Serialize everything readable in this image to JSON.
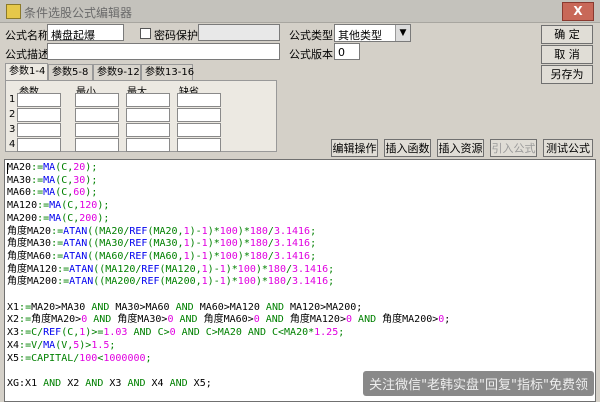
{
  "window": {
    "title": "条件选股公式编辑器",
    "close_label": "X"
  },
  "form": {
    "name_label": "公式名称",
    "name_value": "横盘起爆",
    "password_label": "密码保护",
    "password_checked": false,
    "type_label": "公式类型",
    "type_value": "其他类型",
    "desc_label": "公式描述",
    "desc_value": "",
    "version_label": "公式版本",
    "version_value": "0"
  },
  "buttons": {
    "ok": "确  定",
    "cancel": "取  消",
    "save_as": "另存为",
    "edit_op": "编辑操作",
    "insert_func": "插入函数",
    "insert_resource": "插入资源",
    "import_formula": "引入公式",
    "test_formula": "测试公式"
  },
  "param_tabs": [
    "参数1-4",
    "参数5-8",
    "参数9-12",
    "参数13-16"
  ],
  "param_columns": [
    "参数",
    "最小",
    "最大",
    "缺省"
  ],
  "param_rows": [
    "1",
    "2",
    "3",
    "4"
  ],
  "code_lines": [
    [
      [
        "MA20",
        "plain"
      ],
      [
        ":=",
        "op"
      ],
      [
        "MA",
        "fn"
      ],
      [
        "(C,",
        "op"
      ],
      [
        "20",
        "nm"
      ],
      [
        ");",
        "op"
      ]
    ],
    [
      [
        "MA30",
        "plain"
      ],
      [
        ":=",
        "op"
      ],
      [
        "MA",
        "fn"
      ],
      [
        "(C,",
        "op"
      ],
      [
        "30",
        "nm"
      ],
      [
        ");",
        "op"
      ]
    ],
    [
      [
        "MA60",
        "plain"
      ],
      [
        ":=",
        "op"
      ],
      [
        "MA",
        "fn"
      ],
      [
        "(C,",
        "op"
      ],
      [
        "60",
        "nm"
      ],
      [
        ");",
        "op"
      ]
    ],
    [
      [
        "MA120",
        "plain"
      ],
      [
        ":=",
        "op"
      ],
      [
        "MA",
        "fn"
      ],
      [
        "(C,",
        "op"
      ],
      [
        "120",
        "nm"
      ],
      [
        ");",
        "op"
      ]
    ],
    [
      [
        "MA200",
        "plain"
      ],
      [
        ":=",
        "op"
      ],
      [
        "MA",
        "fn"
      ],
      [
        "(C,",
        "op"
      ],
      [
        "200",
        "nm"
      ],
      [
        ");",
        "op"
      ]
    ],
    [
      [
        "角度MA20",
        "plain"
      ],
      [
        ":=",
        "op"
      ],
      [
        "ATAN",
        "fn"
      ],
      [
        "((MA20/",
        "op"
      ],
      [
        "REF",
        "fn"
      ],
      [
        "(MA20,",
        "op"
      ],
      [
        "1",
        "nm"
      ],
      [
        ")-",
        "op"
      ],
      [
        "1",
        "nm"
      ],
      [
        ")*",
        "op"
      ],
      [
        "100",
        "nm"
      ],
      [
        ")*",
        "op"
      ],
      [
        "180",
        "nm"
      ],
      [
        "/",
        "op"
      ],
      [
        "3.1416",
        "nm"
      ],
      [
        ";",
        "op"
      ]
    ],
    [
      [
        "角度MA30",
        "plain"
      ],
      [
        ":=",
        "op"
      ],
      [
        "ATAN",
        "fn"
      ],
      [
        "((MA30/",
        "op"
      ],
      [
        "REF",
        "fn"
      ],
      [
        "(MA30,",
        "op"
      ],
      [
        "1",
        "nm"
      ],
      [
        ")-",
        "op"
      ],
      [
        "1",
        "nm"
      ],
      [
        ")*",
        "op"
      ],
      [
        "100",
        "nm"
      ],
      [
        ")*",
        "op"
      ],
      [
        "180",
        "nm"
      ],
      [
        "/",
        "op"
      ],
      [
        "3.1416",
        "nm"
      ],
      [
        ";",
        "op"
      ]
    ],
    [
      [
        "角度MA60",
        "plain"
      ],
      [
        ":=",
        "op"
      ],
      [
        "ATAN",
        "fn"
      ],
      [
        "((MA60/",
        "op"
      ],
      [
        "REF",
        "fn"
      ],
      [
        "(MA60,",
        "op"
      ],
      [
        "1",
        "nm"
      ],
      [
        ")-",
        "op"
      ],
      [
        "1",
        "nm"
      ],
      [
        ")*",
        "op"
      ],
      [
        "100",
        "nm"
      ],
      [
        ")*",
        "op"
      ],
      [
        "180",
        "nm"
      ],
      [
        "/",
        "op"
      ],
      [
        "3.1416",
        "nm"
      ],
      [
        ";",
        "op"
      ]
    ],
    [
      [
        "角度MA120",
        "plain"
      ],
      [
        ":=",
        "op"
      ],
      [
        "ATAN",
        "fn"
      ],
      [
        "((MA120/",
        "op"
      ],
      [
        "REF",
        "fn"
      ],
      [
        "(MA120,",
        "op"
      ],
      [
        "1",
        "nm"
      ],
      [
        ")-",
        "op"
      ],
      [
        "1",
        "nm"
      ],
      [
        ")*",
        "op"
      ],
      [
        "100",
        "nm"
      ],
      [
        ")*",
        "op"
      ],
      [
        "180",
        "nm"
      ],
      [
        "/",
        "op"
      ],
      [
        "3.1416",
        "nm"
      ],
      [
        ";",
        "op"
      ]
    ],
    [
      [
        "角度MA200",
        "plain"
      ],
      [
        ":=",
        "op"
      ],
      [
        "ATAN",
        "fn"
      ],
      [
        "((MA200/",
        "op"
      ],
      [
        "REF",
        "fn"
      ],
      [
        "(MA200,",
        "op"
      ],
      [
        "1",
        "nm"
      ],
      [
        ")-",
        "op"
      ],
      [
        "1",
        "nm"
      ],
      [
        ")*",
        "op"
      ],
      [
        "100",
        "nm"
      ],
      [
        ")*",
        "op"
      ],
      [
        "180",
        "nm"
      ],
      [
        "/",
        "op"
      ],
      [
        "3.1416",
        "nm"
      ],
      [
        ";",
        "op"
      ]
    ],
    [],
    [
      [
        "X1",
        "plain"
      ],
      [
        ":=",
        "op"
      ],
      [
        "MA20>MA30 ",
        "plain"
      ],
      [
        "AND",
        "kw"
      ],
      [
        " MA30>MA60 ",
        "plain"
      ],
      [
        "AND",
        "kw"
      ],
      [
        " MA60>MA120 ",
        "plain"
      ],
      [
        "AND",
        "kw"
      ],
      [
        " MA120>MA200;",
        "plain"
      ]
    ],
    [
      [
        "X2",
        "plain"
      ],
      [
        ":=",
        "op"
      ],
      [
        "角度MA20>",
        "plain"
      ],
      [
        "0",
        "nm"
      ],
      [
        " ",
        "plain"
      ],
      [
        "AND",
        "kw"
      ],
      [
        " 角度MA30>",
        "plain"
      ],
      [
        "0",
        "nm"
      ],
      [
        " ",
        "plain"
      ],
      [
        "AND",
        "kw"
      ],
      [
        " 角度MA60>",
        "plain"
      ],
      [
        "0",
        "nm"
      ],
      [
        " ",
        "plain"
      ],
      [
        "AND",
        "kw"
      ],
      [
        " 角度MA120>",
        "plain"
      ],
      [
        "0",
        "nm"
      ],
      [
        " ",
        "plain"
      ],
      [
        "AND",
        "kw"
      ],
      [
        " 角度MA200>",
        "plain"
      ],
      [
        "0",
        "nm"
      ],
      [
        ";",
        "plain"
      ]
    ],
    [
      [
        "X3",
        "plain"
      ],
      [
        ":=",
        "op"
      ],
      [
        "C/",
        "op"
      ],
      [
        "REF",
        "fn"
      ],
      [
        "(C,",
        "op"
      ],
      [
        "1",
        "nm"
      ],
      [
        ")>=",
        "op"
      ],
      [
        "1.03",
        "nm"
      ],
      [
        " ",
        "plain"
      ],
      [
        "AND",
        "kw"
      ],
      [
        " C>",
        "op"
      ],
      [
        "0",
        "nm"
      ],
      [
        " ",
        "plain"
      ],
      [
        "AND",
        "kw"
      ],
      [
        " C>MA20 ",
        "op"
      ],
      [
        "AND",
        "kw"
      ],
      [
        " C<MA20*",
        "op"
      ],
      [
        "1.25",
        "nm"
      ],
      [
        ";",
        "op"
      ]
    ],
    [
      [
        "X4",
        "plain"
      ],
      [
        ":=",
        "op"
      ],
      [
        "V/",
        "op"
      ],
      [
        "MA",
        "fn"
      ],
      [
        "(V,",
        "op"
      ],
      [
        "5",
        "nm"
      ],
      [
        ")>",
        "op"
      ],
      [
        "1.5",
        "nm"
      ],
      [
        ";",
        "op"
      ]
    ],
    [
      [
        "X5",
        "plain"
      ],
      [
        ":=",
        "op"
      ],
      [
        "CAPITAL/",
        "op"
      ],
      [
        "100",
        "nm"
      ],
      [
        "<",
        "op"
      ],
      [
        "1000000",
        "nm"
      ],
      [
        ";",
        "op"
      ]
    ],
    [],
    [
      [
        "XG:X1 ",
        "plain"
      ],
      [
        "AND",
        "kw"
      ],
      [
        " X2 ",
        "plain"
      ],
      [
        "AND",
        "kw"
      ],
      [
        " X3 ",
        "plain"
      ],
      [
        "AND",
        "kw"
      ],
      [
        " X4 ",
        "plain"
      ],
      [
        "AND",
        "kw"
      ],
      [
        " X5;",
        "plain"
      ]
    ]
  ],
  "watermark": "关注微信\"老韩实盘\"回复\"指标\"免费领"
}
